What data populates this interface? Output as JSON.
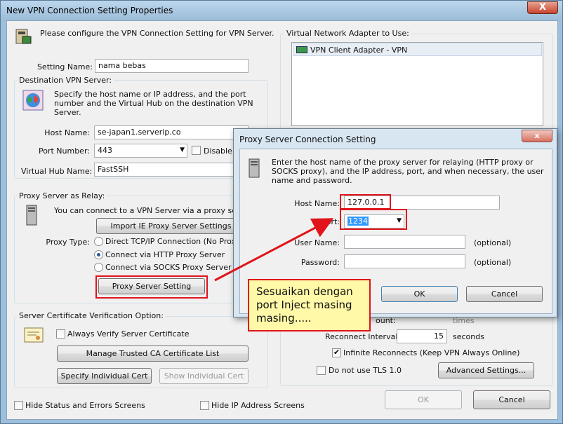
{
  "main": {
    "title": "New VPN Connection Setting Properties",
    "close_label": "X",
    "intro": "Please configure the VPN Connection Setting for VPN Server.",
    "setting_name_label": "Setting Name:",
    "setting_name_value": "nama bebas",
    "dest_group": "Destination VPN Server:",
    "dest_desc": "Specify the host name or IP address, and the port number and the Virtual Hub on the destination VPN Server.",
    "host_label": "Host Name:",
    "host_value": "se-japan1.serverip.co",
    "port_label": "Port Number:",
    "port_value": "443",
    "disable_label": "Disable N",
    "hub_label": "Virtual Hub Name:",
    "hub_value": "FastSSH",
    "proxy_group": "Proxy Server as Relay:",
    "proxy_desc": "You can connect to a VPN Server via a proxy server.",
    "import_ie": "Import IE Proxy Server Settings",
    "proxy_type_label": "Proxy Type:",
    "radio_direct": "Direct TCP/IP Connection (No Proxy)",
    "radio_http": "Connect via HTTP Proxy Server",
    "radio_socks": "Connect via SOCKS Proxy Server",
    "proxy_setting_btn": "Proxy Server Setting",
    "cert_group": "Server Certificate Verification Option:",
    "always_verify": "Always Verify Server Certificate",
    "manage_ca": "Manage Trusted CA Certificate List",
    "specify_cert": "Specify Individual Cert",
    "show_cert": "Show Individual Cert",
    "hide_status": "Hide Status and Errors Screens",
    "hide_ip": "Hide IP Address Screens",
    "adapter_group": "Virtual Network Adapter to Use:",
    "adapter_item": "VPN Client Adapter - VPN",
    "count_frag": "ount:",
    "times": "times",
    "reconnect_label": "Reconnect Interval:",
    "reconnect_value": "15",
    "seconds": "seconds",
    "infinite_label": "Infinite Reconnects (Keep VPN Always Online)",
    "no_tls": "Do not use TLS 1.0",
    "advanced_btn": "Advanced Settings...",
    "ok": "OK",
    "cancel": "Cancel"
  },
  "proxy": {
    "title": "Proxy Server Connection Setting",
    "close_label": "x",
    "desc": "Enter the host name of the proxy server for relaying (HTTP proxy or SOCKS proxy), and the IP address, port, and when necessary, the user name and password.",
    "host_label": "Host Name:",
    "host_value": "127.0.0.1",
    "port_label": "Port:",
    "port_value": "1234",
    "user_label": "User Name:",
    "password_label": "Password:",
    "optional1": "(optional)",
    "optional2": "(optional)",
    "ok": "OK",
    "cancel": "Cancel"
  },
  "annotation": {
    "text": "Sesuaikan dengan port Inject masing masing.....",
    "color": "#e0141a"
  }
}
